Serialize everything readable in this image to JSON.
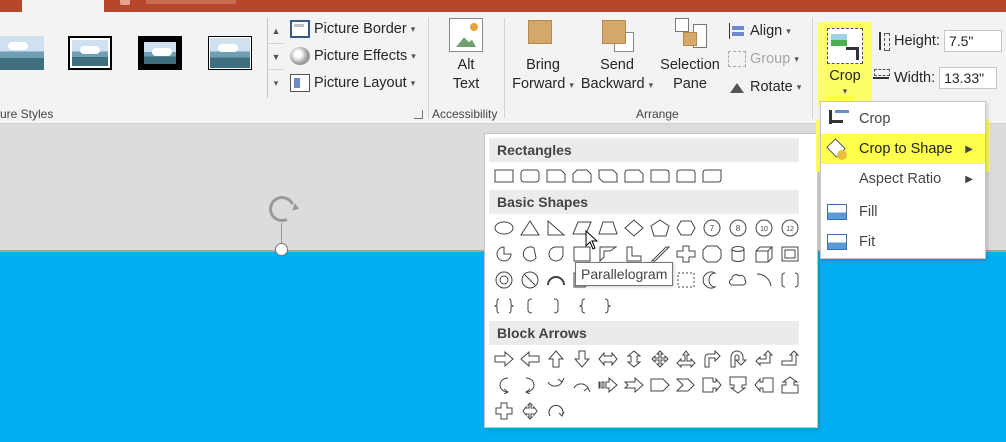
{
  "ribbon": {
    "picture_styles_label": "ure Styles",
    "picture_border": "Picture Border",
    "picture_effects": "Picture Effects",
    "picture_layout": "Picture Layout",
    "alt_text_line1": "Alt",
    "alt_text_line2": "Text",
    "accessibility_label": "Accessibility",
    "bring_forward_line1": "Bring",
    "bring_forward_line2": "Forward",
    "send_backward_line1": "Send",
    "send_backward_line2": "Backward",
    "selection_pane_line1": "Selection",
    "selection_pane_line2": "Pane",
    "align": "Align",
    "group": "Group",
    "rotate": "Rotate",
    "arrange_label": "Arrange",
    "crop": "Crop",
    "height_label": "Height:",
    "height_value": "7.5\"",
    "width_label": "Width:",
    "width_value": "13.33\""
  },
  "shapes_menu": {
    "categories": [
      "Rectangles",
      "Basic Shapes",
      "Block Arrows"
    ]
  },
  "tooltip": "Parallelogram",
  "crop_menu": {
    "items": [
      {
        "label": "Crop",
        "has_submenu": false
      },
      {
        "label": "Crop to Shape",
        "has_submenu": true
      },
      {
        "label": "Aspect Ratio",
        "has_submenu": true
      },
      {
        "label": "Fill",
        "has_submenu": false
      },
      {
        "label": "Fit",
        "has_submenu": false
      }
    ]
  },
  "colors": {
    "title_bar": "#b7472a",
    "highlight": "#ffff4d",
    "slide_shape": "#00b0f0"
  }
}
